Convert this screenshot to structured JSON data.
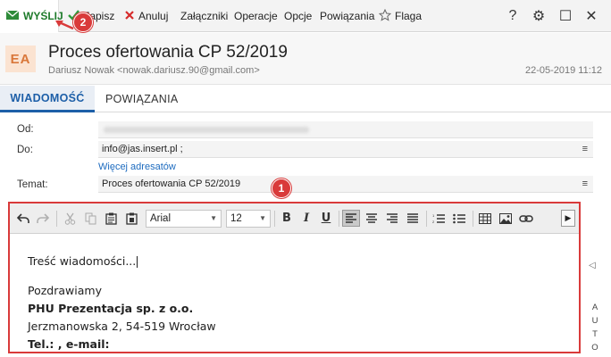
{
  "toolbar": {
    "send": "WYŚLIJ",
    "save": "Zapisz",
    "cancel": "Anuluj",
    "attachments": "Załączniki",
    "operations": "Operacje",
    "options": "Opcje",
    "links": "Powiązania",
    "flag": "Flaga",
    "help_glyph": "?",
    "settings_glyph": "⚙",
    "window_glyph": "☐",
    "close_glyph": "✕"
  },
  "header": {
    "avatar_initials": "EA",
    "title": "Proces ofertowania CP 52/2019",
    "from": "Dariusz Nowak <nowak.dariusz.90@gmail.com>",
    "date": "22-05-2019 11:12"
  },
  "tabs": [
    {
      "label": "WIADOMOŚĆ",
      "active": true
    },
    {
      "label": "POWIĄZANIA",
      "active": false
    }
  ],
  "form": {
    "from_label": "Od:",
    "to_label": "Do:",
    "to_value": "info@jas.insert.pl ;",
    "more_addresses": "Więcej adresatów",
    "subject_label": "Temat:",
    "subject_value": "Proces ofertowania CP 52/2019",
    "menu_glyph": "≡"
  },
  "editor": {
    "font": "Arial",
    "size": "12",
    "bold_glyph": "B",
    "italic_glyph": "I",
    "underline_glyph": "U",
    "body_lines": [
      "Treść wiadomości...",
      "Pozdrawiamy",
      "PHU Prezentacja sp. z o.o.",
      "Jerzmanowska 2, 54-519 Wrocław",
      "Tel.: , e-mail:"
    ]
  },
  "side_panel": {
    "arrow": "◁",
    "letters": [
      "A",
      "U",
      "T",
      "O"
    ]
  },
  "callouts": {
    "one": "1",
    "two": "2"
  },
  "colors": {
    "accent_blue": "#1d5fa8",
    "send_green": "#1d7a2a",
    "callout_red": "#d93a3a",
    "avatar_bg": "#fbe3d1",
    "avatar_fg": "#d9773a"
  }
}
